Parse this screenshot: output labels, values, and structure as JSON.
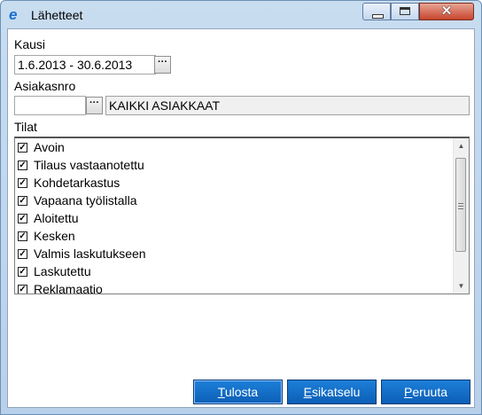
{
  "window": {
    "title": "Lähetteet",
    "minimize_label": "",
    "maximize_label": "",
    "close_label": "✕"
  },
  "kausi": {
    "label": "Kausi",
    "value": "1.6.2013 - 30.6.2013",
    "browse_label": "···"
  },
  "asiakasnro": {
    "label": "Asiakasnro",
    "value": "",
    "browse_label": "···",
    "name_value": "KAIKKI ASIAKKAAT"
  },
  "tilat": {
    "label": "Tilat",
    "check_mark": "✓",
    "items": [
      {
        "label": "Avoin",
        "checked": true
      },
      {
        "label": "Tilaus vastaanotettu",
        "checked": true
      },
      {
        "label": "Kohdetarkastus",
        "checked": true
      },
      {
        "label": "Vapaana työlistalla",
        "checked": true
      },
      {
        "label": "Aloitettu",
        "checked": true
      },
      {
        "label": "Kesken",
        "checked": true
      },
      {
        "label": "Valmis laskutukseen",
        "checked": true
      },
      {
        "label": "Laskutettu",
        "checked": true
      },
      {
        "label": "Reklamaatio",
        "checked": true
      }
    ],
    "scroll_up": "▲",
    "scroll_down": "▼"
  },
  "buttons": {
    "print_first": "T",
    "print_rest": "ulosta",
    "preview_first": "E",
    "preview_rest": "sikatselu",
    "cancel_first": "P",
    "cancel_rest": "eruuta"
  }
}
